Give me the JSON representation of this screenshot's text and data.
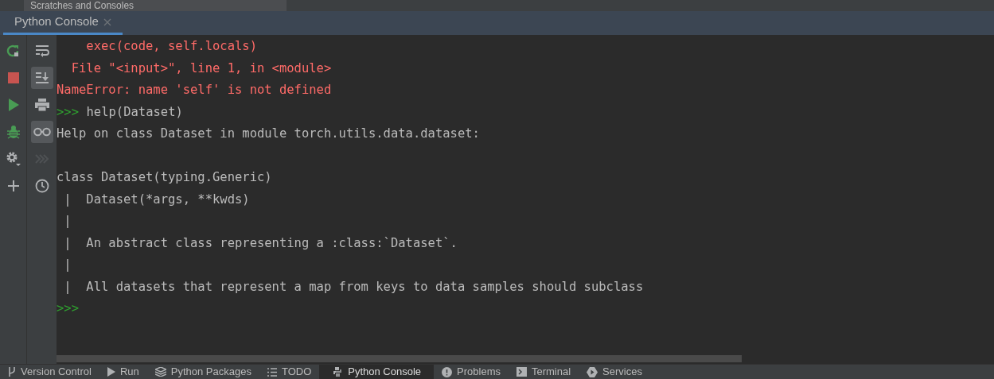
{
  "top_strip": {
    "title": "Scratches and Consoles"
  },
  "tabs": [
    {
      "label": "Python Console",
      "selected": true,
      "closable": true
    }
  ],
  "left_toolbar": [
    {
      "kind": "rerun"
    },
    {
      "kind": "stop"
    },
    {
      "kind": "run"
    },
    {
      "kind": "debug"
    },
    {
      "kind": "settings"
    },
    {
      "kind": "add"
    }
  ],
  "side_toolbar": [
    {
      "kind": "wrap",
      "selected": false
    },
    {
      "kind": "scroll-end",
      "selected": true
    },
    {
      "kind": "print",
      "selected": false
    },
    {
      "kind": "glasses",
      "selected": true
    },
    {
      "kind": "forward",
      "selected": false,
      "disabled": true
    },
    {
      "kind": "history",
      "selected": false
    }
  ],
  "console_lines": [
    {
      "kind": "error",
      "text": "    exec(code, self.locals)"
    },
    {
      "kind": "error",
      "text": "  File \"<input>\", line 1, in <module>"
    },
    {
      "kind": "error",
      "text": "NameError: name 'self' is not defined"
    },
    {
      "kind": "input",
      "prompt": ">>>",
      "text": "help(Dataset)"
    },
    {
      "kind": "output",
      "text": "Help on class Dataset in module torch.utils.data.dataset:"
    },
    {
      "kind": "blank"
    },
    {
      "kind": "output",
      "text": "class Dataset(typing.Generic)"
    },
    {
      "kind": "output",
      "text": " |  Dataset(*args, **kwds)"
    },
    {
      "kind": "output",
      "text": " |"
    },
    {
      "kind": "output",
      "text": " |  An abstract class representing a :class:`Dataset`."
    },
    {
      "kind": "output",
      "text": " |"
    },
    {
      "kind": "output",
      "text": " |  All datasets that represent a map from keys to data samples should subclass"
    },
    {
      "kind": "input",
      "prompt": ">>>"
    }
  ],
  "bottom_tabs": [
    {
      "kind": "vcs",
      "label": "Version Control",
      "selected": false
    },
    {
      "kind": "run",
      "label": "Run",
      "selected": false
    },
    {
      "kind": "packages",
      "label": "Python Packages",
      "selected": false
    },
    {
      "kind": "todo",
      "label": "TODO",
      "selected": false
    },
    {
      "kind": "python",
      "label": "Python Console",
      "selected": true
    },
    {
      "kind": "problems",
      "label": "Problems",
      "selected": false
    },
    {
      "kind": "terminal",
      "label": "Terminal",
      "selected": false
    },
    {
      "kind": "services",
      "label": "Services",
      "selected": false
    }
  ]
}
